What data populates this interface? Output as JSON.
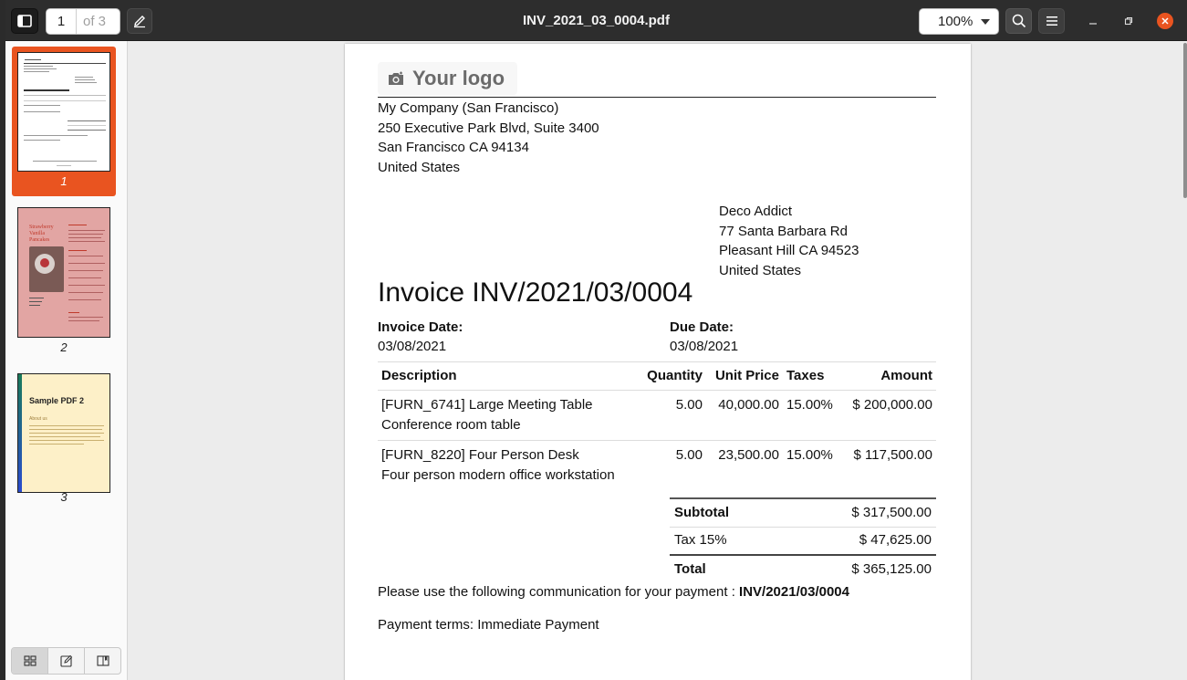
{
  "header": {
    "current_page": "1",
    "page_count_label": "of 3",
    "title": "INV_2021_03_0004.pdf",
    "zoom": "100%"
  },
  "sidebar": {
    "thumbnails": [
      {
        "label": "1",
        "selected": true
      },
      {
        "label": "2",
        "selected": false
      },
      {
        "label": "3",
        "selected": false
      }
    ],
    "thumb2_title": "Strawberry Vanilla Pancakes",
    "thumb3_title": "Sample PDF 2",
    "thumb3_subtitle": "About us"
  },
  "invoice": {
    "logo_text": "Your logo",
    "company": [
      "My Company (San Francisco)",
      "250 Executive Park Blvd, Suite 3400",
      "San Francisco CA 94134",
      "United States"
    ],
    "customer": [
      "Deco Addict",
      "77 Santa Barbara Rd",
      "Pleasant Hill CA 94523",
      "United States"
    ],
    "title": "Invoice INV/2021/03/0004",
    "invoice_date_label": "Invoice Date:",
    "invoice_date": "03/08/2021",
    "due_date_label": "Due Date:",
    "due_date": "03/08/2021",
    "columns": {
      "description": "Description",
      "quantity": "Quantity",
      "unit_price": "Unit Price",
      "taxes": "Taxes",
      "amount": "Amount"
    },
    "lines": [
      {
        "desc1": "[FURN_6741] Large Meeting Table",
        "desc2": "Conference room table",
        "quantity": "5.00",
        "unit_price": "40,000.00",
        "taxes": "15.00%",
        "amount": "$ 200,000.00"
      },
      {
        "desc1": "[FURN_8220] Four Person Desk",
        "desc2": "Four person modern office workstation",
        "quantity": "5.00",
        "unit_price": "23,500.00",
        "taxes": "15.00%",
        "amount": "$ 117,500.00"
      }
    ],
    "subtotal_label": "Subtotal",
    "subtotal": "$ 317,500.00",
    "tax_label": "Tax 15%",
    "tax": "$ 47,625.00",
    "total_label": "Total",
    "total": "$ 365,125.00",
    "communication_text": "Please use the following communication for your payment :",
    "communication_ref": "INV/2021/03/0004",
    "payment_terms": "Payment terms: Immediate Payment"
  },
  "colors": {
    "accent": "#e95420",
    "header_bg": "#2d2d2d"
  }
}
